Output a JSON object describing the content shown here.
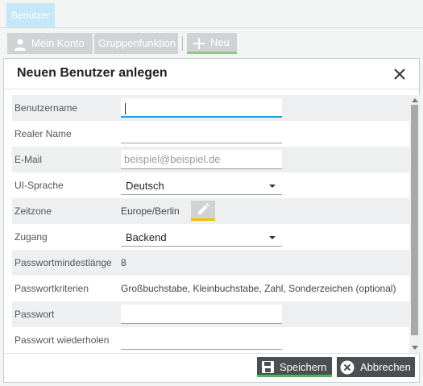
{
  "top_tab": {
    "label": "Benutzer"
  },
  "toolbar": {
    "my_account": "Mein Konto",
    "group_function": "Gruppenfunktion",
    "new": "Neu"
  },
  "dialog": {
    "title": "Neuen Benutzer anlegen",
    "fields": {
      "username": {
        "label": "Benutzername",
        "value": ""
      },
      "real_name": {
        "label": "Realer Name",
        "value": ""
      },
      "email": {
        "label": "E-Mail",
        "placeholder": "beispiel@beispiel.de"
      },
      "ui_language": {
        "label": "UI-Sprache",
        "value": "Deutsch"
      },
      "timezone": {
        "label": "Zeitzone",
        "value": "Europe/Berlin"
      },
      "access": {
        "label": "Zugang",
        "value": "Backend"
      },
      "pw_min_length": {
        "label": "Passwortmindestlänge",
        "value": "8"
      },
      "pw_criteria": {
        "label": "Passwortkriterien",
        "value": "Großbuchstabe, Kleinbuchstabe, Zahl, Sonderzeichen (optional)"
      },
      "password": {
        "label": "Passwort",
        "value": ""
      },
      "password_repeat": {
        "label": "Passwort wiederholen",
        "value": ""
      }
    },
    "buttons": {
      "save": "Speichern",
      "cancel": "Abbrechen"
    }
  },
  "colors": {
    "tab_active": "#c4e8f8",
    "toolbar_button": "#d0d3d4",
    "footer_button": "#4a4f52",
    "save_accent": "#58b35e",
    "new_accent": "#8bc98d",
    "focus": "#1ba3e0",
    "edit_accent": "#f2c200"
  },
  "icons": {
    "my_account": "user-icon",
    "new": "plus-icon",
    "close": "close-icon",
    "timezone_edit": "pencil-icon",
    "save": "floppy-disk-icon",
    "cancel": "cancel-circle-icon"
  }
}
